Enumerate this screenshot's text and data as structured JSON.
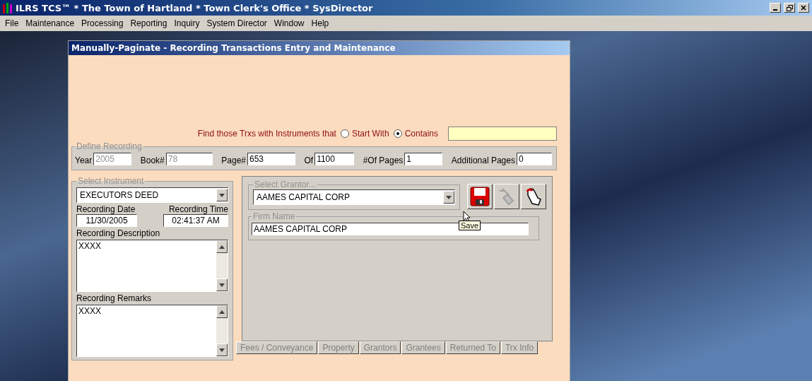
{
  "app": {
    "title": "ILRS TCS™ * The Town of Hartland * Town Clerk's Office * SysDirector"
  },
  "menu": [
    "File",
    "Maintenance",
    "Processing",
    "Reporting",
    "Inquiry",
    "System Director",
    "Window",
    "Help"
  ],
  "form": {
    "title": "Manually-Paginate - Recording Transactions Entry and Maintenance",
    "search": {
      "label": "Find those Trxs with Instruments that",
      "options": [
        {
          "label": "Start With",
          "selected": false
        },
        {
          "label": "Contains",
          "selected": true
        }
      ]
    },
    "define_recording": {
      "title": "Define Recording",
      "fields": [
        {
          "label": "Year",
          "value": "2005",
          "disabled": true
        },
        {
          "label": "Book#",
          "value": "78",
          "disabled": true
        },
        {
          "label": "Page#",
          "value": "653",
          "disabled": false
        },
        {
          "label": "Of",
          "value": "1100",
          "disabled": false
        },
        {
          "label": "#Of Pages",
          "value": "1",
          "disabled": false
        },
        {
          "label": "Additional Pages",
          "value": "0",
          "disabled": false
        }
      ]
    },
    "instrument": {
      "title": "Select Instrument",
      "value": "EXECUTORS DEED",
      "date_label": "Recording Date",
      "date": "11/30/2005",
      "time_label": "Recording Time",
      "time": "02:41:37 AM",
      "description_label": "Recording Description",
      "description": "XXXX",
      "remarks_label": "Recording Remarks",
      "remarks": "XXXX"
    },
    "grantor": {
      "title": "Select Grantor...",
      "value": "AAMES CAPITAL CORP",
      "firm_label": "Firm Name",
      "firm": "AAMES CAPITAL CORP",
      "tooltip": "Save"
    },
    "tabs": [
      {
        "label": "Fees / Conveyance",
        "selected": false
      },
      {
        "label": "Property",
        "selected": false
      },
      {
        "label": "Grantors",
        "selected": false
      },
      {
        "label": "Grantees",
        "selected": false
      },
      {
        "label": "Returned To",
        "selected": false
      },
      {
        "label": "Trx Info",
        "selected": false
      }
    ]
  }
}
